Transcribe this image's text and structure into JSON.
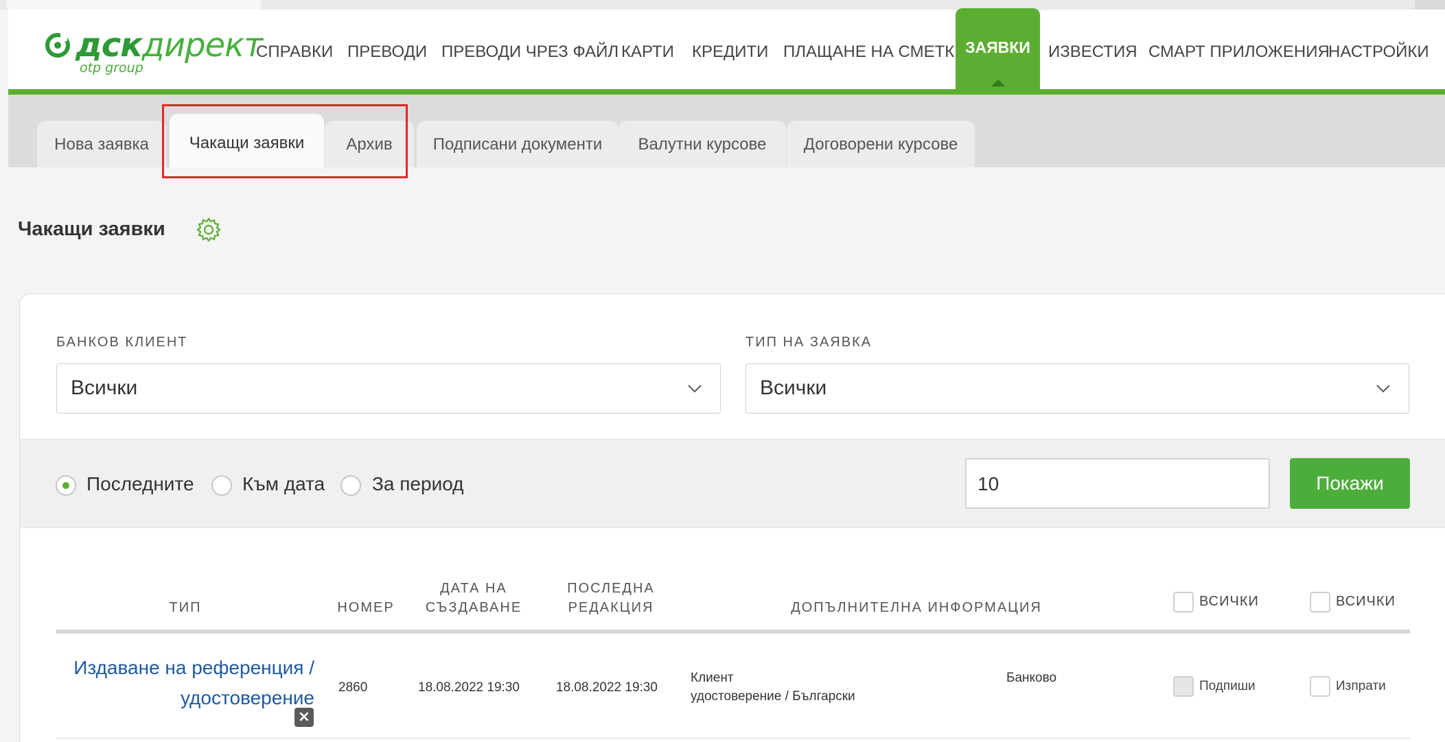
{
  "logo": {
    "word_bold": "дск",
    "word_light": "директ",
    "sub": "otp group"
  },
  "nav": {
    "items": [
      "СПРАВКИ",
      "ПРЕВОДИ",
      "ПРЕВОДИ ЧРЕЗ ФАЙЛ",
      "КАРТИ",
      "КРЕДИТИ",
      "ПЛАЩАНЕ НА СМЕТКИ",
      "ЗАЯВКИ",
      "ИЗВЕСТИЯ",
      "СМАРТ ПРИЛОЖЕНИЯ",
      "НАСТРОЙКИ"
    ],
    "active": "ЗАЯВКИ"
  },
  "tabs": {
    "items": [
      "Нова заявка",
      "Чакащи заявки",
      "Архив",
      "Подписани документи",
      "Валутни курсове",
      "Договорени курсове"
    ],
    "active": "Чакащи заявки"
  },
  "page": {
    "title": "Чакащи заявки"
  },
  "filters": {
    "client_label": "БАНКОВ КЛИЕНТ",
    "client_value": "Всички",
    "type_label": "ТИП НА ЗАЯВКА",
    "type_value": "Всички",
    "radios": [
      "Последните",
      "Към дата",
      "За период"
    ],
    "radio_selected": "Последните",
    "count_value": "10",
    "show_button": "Покажи"
  },
  "table": {
    "headers": {
      "type": "ТИП",
      "number": "НОМЕР",
      "created_1": "ДАТА НА",
      "created_2": "СЪЗДАВАНЕ",
      "edited_1": "ПОСЛЕДНА",
      "edited_2": "РЕДАКЦИЯ",
      "info": "ДОПЪЛНИТЕЛНА ИНФОРМАЦИЯ",
      "all_sign": "ВСИЧКИ",
      "all_send": "ВСИЧКИ"
    },
    "rows": [
      {
        "type_line1": "Издаване на референция /",
        "type_line2": "удостоверение",
        "number": "2860",
        "created": "18.08.2022 19:30",
        "edited": "18.08.2022 19:30",
        "info_1": "Клиент",
        "info_2": "удостоверение / Български",
        "info_3": "Банково",
        "sign_label": "Подпиши",
        "send_label": "Изпрати"
      }
    ]
  },
  "colors": {
    "brand_green": "#5cae33",
    "button_green": "#4cae3a",
    "link_blue": "#1e5aa0",
    "highlight_red": "#e32626"
  }
}
